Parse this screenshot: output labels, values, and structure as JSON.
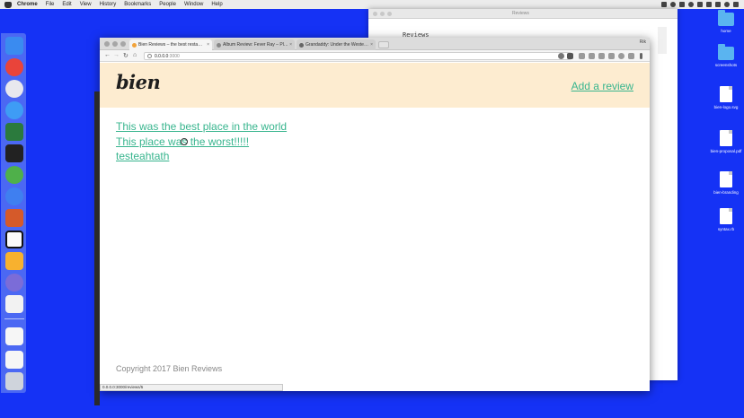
{
  "menubar": {
    "app": "Chrome",
    "items": [
      "File",
      "Edit",
      "View",
      "History",
      "Bookmarks",
      "People",
      "Window",
      "Help"
    ]
  },
  "background_window": {
    "title": "Reviews",
    "content": "Reviews"
  },
  "desktop_icons": [
    {
      "label": "home",
      "type": "folder"
    },
    {
      "label": "screenshots",
      "type": "folder"
    },
    {
      "label": "bien-logo.svg",
      "type": "doc"
    },
    {
      "label": "bien-proposal.pdf",
      "type": "doc"
    },
    {
      "label": "bien-branding",
      "type": "doc"
    },
    {
      "label": "syntax.rb",
      "type": "doc"
    }
  ],
  "browser": {
    "tabs": [
      {
        "title": "Bien Reviews – the best resta…",
        "active": true,
        "color": "#f2a33a"
      },
      {
        "title": "Album Review: Fever Ray – Pl…",
        "active": false,
        "color": "#888888"
      },
      {
        "title": "Grandaddy: Under the Weste…",
        "active": false,
        "color": "#666666"
      }
    ],
    "profile": "Rik",
    "url_host": "0.0.0.0",
    "url_port": ":3000",
    "status_url": "0.0.0.0:3000/reviews/5"
  },
  "site": {
    "logo": "bien",
    "add_review": "Add a review",
    "reviews": [
      "This was the best place in the world",
      "This place was the worst!!!!!",
      "testeahtath"
    ],
    "footer": "Copyright 2017 Bien Reviews",
    "accent_color": "#38b58e",
    "header_color": "#fdecd0"
  }
}
